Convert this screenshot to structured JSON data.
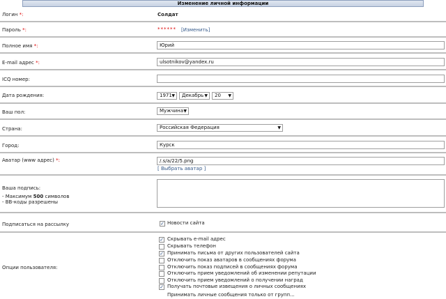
{
  "header": {
    "title": "Изменение личной информации"
  },
  "login": {
    "label": "Логин",
    "req": "*:",
    "value": "Солдат"
  },
  "password": {
    "label": "Пароль",
    "req": "*:",
    "mask": "******",
    "change_link": "[Изменить]"
  },
  "fullname": {
    "label": "Полное имя",
    "req": "*:",
    "value": "Юрий"
  },
  "email": {
    "label": "E-mail адрес",
    "req": "*:",
    "value": "ulsotnikov@yandex.ru"
  },
  "icq": {
    "label": "ICQ номер:",
    "value": ""
  },
  "birthdate": {
    "label": "Дата рождения:",
    "year": "1971",
    "month": "Декабрь",
    "day": "20"
  },
  "gender": {
    "label": "Ваш пол:",
    "value": "Мужчина"
  },
  "country": {
    "label": "Страна:",
    "value": "Российская Федерация"
  },
  "city": {
    "label": "Город:",
    "value": "Курск"
  },
  "avatar": {
    "label": "Аватар (www адрес)",
    "req": "*:",
    "value": "/.s/a/22/5.png",
    "choose_link": "[ Выбрать аватар ]"
  },
  "signature": {
    "label": "Ваша подпись:",
    "hint1_prefix": "- Максимум ",
    "hint1_bold": "500",
    "hint1_suffix": " символов",
    "hint2": "- BB-коды разрешены",
    "value": ""
  },
  "newsletter": {
    "label": "Подписаться на рассылку",
    "option": "Новости сайта",
    "checked": true
  },
  "options": {
    "label": "Опции пользователя:",
    "items": [
      {
        "label": "Скрывать e-mail адрес",
        "checked": true
      },
      {
        "label": "Скрывать телефон",
        "checked": false
      },
      {
        "label": "Принимать письма от других пользователей сайта",
        "checked": true
      },
      {
        "label": "Отключить показ аватаров в сообщениях форума",
        "checked": false
      },
      {
        "label": "Отключить показ подписей в сообщениях форума",
        "checked": false
      },
      {
        "label": "Отключить прием уведомлений об изменении репутации",
        "checked": false
      },
      {
        "label": "Отключить прием уведомлений о получении наград",
        "checked": false
      },
      {
        "label": "Получать почтовые извещения о личных сообщениях",
        "checked": true
      }
    ],
    "groups_link": "Принимать личные сообщения только от групп..."
  }
}
